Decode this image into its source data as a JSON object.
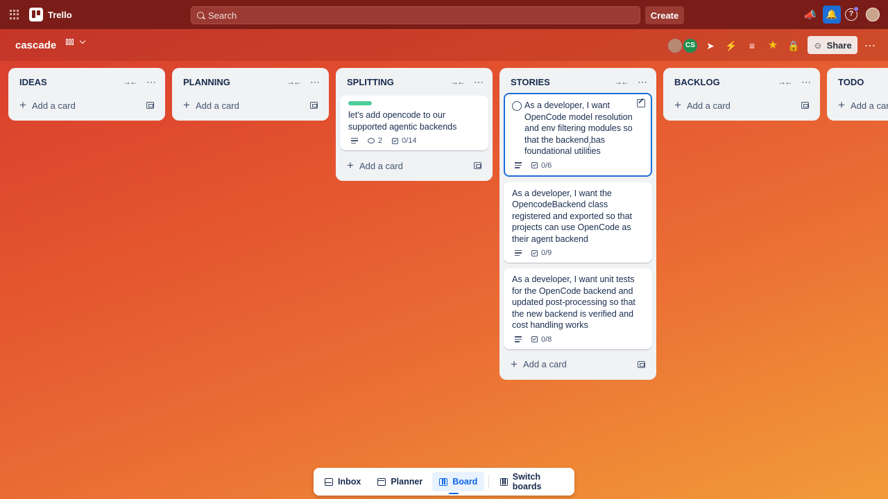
{
  "app": {
    "name": "Trello"
  },
  "header": {
    "search_placeholder": "Search",
    "create_label": "Create"
  },
  "board": {
    "title": "cascade",
    "members": [
      {
        "initials": ""
      },
      {
        "initials": "CS"
      }
    ],
    "share_label": "Share"
  },
  "lists": [
    {
      "title": "IDEAS",
      "add_label": "Add a card",
      "cards": []
    },
    {
      "title": "PLANNING",
      "add_label": "Add a card",
      "cards": []
    },
    {
      "title": "SPLITTING",
      "add_label": "Add a card",
      "cards": [
        {
          "text": "let's add opencode to our supported agentic backends",
          "comments": "2",
          "checklist": "0/14",
          "label_color": "#4bce97"
        }
      ]
    },
    {
      "title": "STORIES",
      "add_label": "Add a card",
      "cards": [
        {
          "text": "As a developer, I want OpenCode model resolution and env filtering modules so that the backend has foundational utilities",
          "checklist": "0/6"
        },
        {
          "text": "As a developer, I want the OpencodeBackend class registered and exported so that projects can use OpenCode as their agent backend",
          "checklist": "0/9"
        },
        {
          "text": "As a developer, I want unit tests for the OpenCode backend and updated post-processing so that the new backend is verified and cost handling works",
          "checklist": "0/8"
        }
      ]
    },
    {
      "title": "BACKLOG",
      "add_label": "Add a card",
      "cards": []
    },
    {
      "title": "TODO",
      "add_label": "Add a card",
      "cards": []
    }
  ],
  "bottom_nav": {
    "inbox": "Inbox",
    "planner": "Planner",
    "board": "Board",
    "switch": "Switch boards"
  },
  "colors": {
    "header_bg": "#7a1d18",
    "accent": "#1d6ed6",
    "label_green": "#4bce97"
  }
}
